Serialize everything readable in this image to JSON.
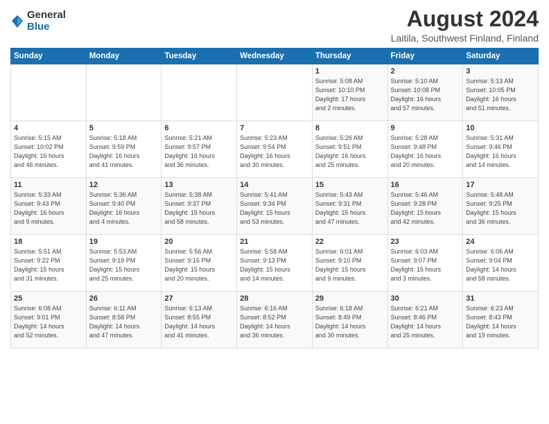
{
  "header": {
    "logo_general": "General",
    "logo_blue": "Blue",
    "title": "August 2024",
    "location": "Laitila, Southwest Finland, Finland"
  },
  "weekdays": [
    "Sunday",
    "Monday",
    "Tuesday",
    "Wednesday",
    "Thursday",
    "Friday",
    "Saturday"
  ],
  "weeks": [
    [
      {
        "day": "",
        "info": ""
      },
      {
        "day": "",
        "info": ""
      },
      {
        "day": "",
        "info": ""
      },
      {
        "day": "",
        "info": ""
      },
      {
        "day": "1",
        "info": "Sunrise: 5:08 AM\nSunset: 10:10 PM\nDaylight: 17 hours\nand 2 minutes."
      },
      {
        "day": "2",
        "info": "Sunrise: 5:10 AM\nSunset: 10:08 PM\nDaylight: 16 hours\nand 57 minutes."
      },
      {
        "day": "3",
        "info": "Sunrise: 5:13 AM\nSunset: 10:05 PM\nDaylight: 16 hours\nand 51 minutes."
      }
    ],
    [
      {
        "day": "4",
        "info": "Sunrise: 5:15 AM\nSunset: 10:02 PM\nDaylight: 16 hours\nand 46 minutes."
      },
      {
        "day": "5",
        "info": "Sunrise: 5:18 AM\nSunset: 9:59 PM\nDaylight: 16 hours\nand 41 minutes."
      },
      {
        "day": "6",
        "info": "Sunrise: 5:21 AM\nSunset: 9:57 PM\nDaylight: 16 hours\nand 36 minutes."
      },
      {
        "day": "7",
        "info": "Sunrise: 5:23 AM\nSunset: 9:54 PM\nDaylight: 16 hours\nand 30 minutes."
      },
      {
        "day": "8",
        "info": "Sunrise: 5:26 AM\nSunset: 9:51 PM\nDaylight: 16 hours\nand 25 minutes."
      },
      {
        "day": "9",
        "info": "Sunrise: 5:28 AM\nSunset: 9:48 PM\nDaylight: 16 hours\nand 20 minutes."
      },
      {
        "day": "10",
        "info": "Sunrise: 5:31 AM\nSunset: 9:46 PM\nDaylight: 16 hours\nand 14 minutes."
      }
    ],
    [
      {
        "day": "11",
        "info": "Sunrise: 5:33 AM\nSunset: 9:43 PM\nDaylight: 16 hours\nand 9 minutes."
      },
      {
        "day": "12",
        "info": "Sunrise: 5:36 AM\nSunset: 9:40 PM\nDaylight: 16 hours\nand 4 minutes."
      },
      {
        "day": "13",
        "info": "Sunrise: 5:38 AM\nSunset: 9:37 PM\nDaylight: 15 hours\nand 58 minutes."
      },
      {
        "day": "14",
        "info": "Sunrise: 5:41 AM\nSunset: 9:34 PM\nDaylight: 15 hours\nand 53 minutes."
      },
      {
        "day": "15",
        "info": "Sunrise: 5:43 AM\nSunset: 9:31 PM\nDaylight: 15 hours\nand 47 minutes."
      },
      {
        "day": "16",
        "info": "Sunrise: 5:46 AM\nSunset: 9:28 PM\nDaylight: 15 hours\nand 42 minutes."
      },
      {
        "day": "17",
        "info": "Sunrise: 5:48 AM\nSunset: 9:25 PM\nDaylight: 15 hours\nand 36 minutes."
      }
    ],
    [
      {
        "day": "18",
        "info": "Sunrise: 5:51 AM\nSunset: 9:22 PM\nDaylight: 15 hours\nand 31 minutes."
      },
      {
        "day": "19",
        "info": "Sunrise: 5:53 AM\nSunset: 9:19 PM\nDaylight: 15 hours\nand 25 minutes."
      },
      {
        "day": "20",
        "info": "Sunrise: 5:56 AM\nSunset: 9:16 PM\nDaylight: 15 hours\nand 20 minutes."
      },
      {
        "day": "21",
        "info": "Sunrise: 5:58 AM\nSunset: 9:13 PM\nDaylight: 15 hours\nand 14 minutes."
      },
      {
        "day": "22",
        "info": "Sunrise: 6:01 AM\nSunset: 9:10 PM\nDaylight: 15 hours\nand 9 minutes."
      },
      {
        "day": "23",
        "info": "Sunrise: 6:03 AM\nSunset: 9:07 PM\nDaylight: 15 hours\nand 3 minutes."
      },
      {
        "day": "24",
        "info": "Sunrise: 6:06 AM\nSunset: 9:04 PM\nDaylight: 14 hours\nand 58 minutes."
      }
    ],
    [
      {
        "day": "25",
        "info": "Sunrise: 6:08 AM\nSunset: 9:01 PM\nDaylight: 14 hours\nand 52 minutes."
      },
      {
        "day": "26",
        "info": "Sunrise: 6:11 AM\nSunset: 8:58 PM\nDaylight: 14 hours\nand 47 minutes."
      },
      {
        "day": "27",
        "info": "Sunrise: 6:13 AM\nSunset: 8:55 PM\nDaylight: 14 hours\nand 41 minutes."
      },
      {
        "day": "28",
        "info": "Sunrise: 6:16 AM\nSunset: 8:52 PM\nDaylight: 14 hours\nand 36 minutes."
      },
      {
        "day": "29",
        "info": "Sunrise: 6:18 AM\nSunset: 8:49 PM\nDaylight: 14 hours\nand 30 minutes."
      },
      {
        "day": "30",
        "info": "Sunrise: 6:21 AM\nSunset: 8:46 PM\nDaylight: 14 hours\nand 25 minutes."
      },
      {
        "day": "31",
        "info": "Sunrise: 6:23 AM\nSunset: 8:43 PM\nDaylight: 14 hours\nand 19 minutes."
      }
    ]
  ]
}
